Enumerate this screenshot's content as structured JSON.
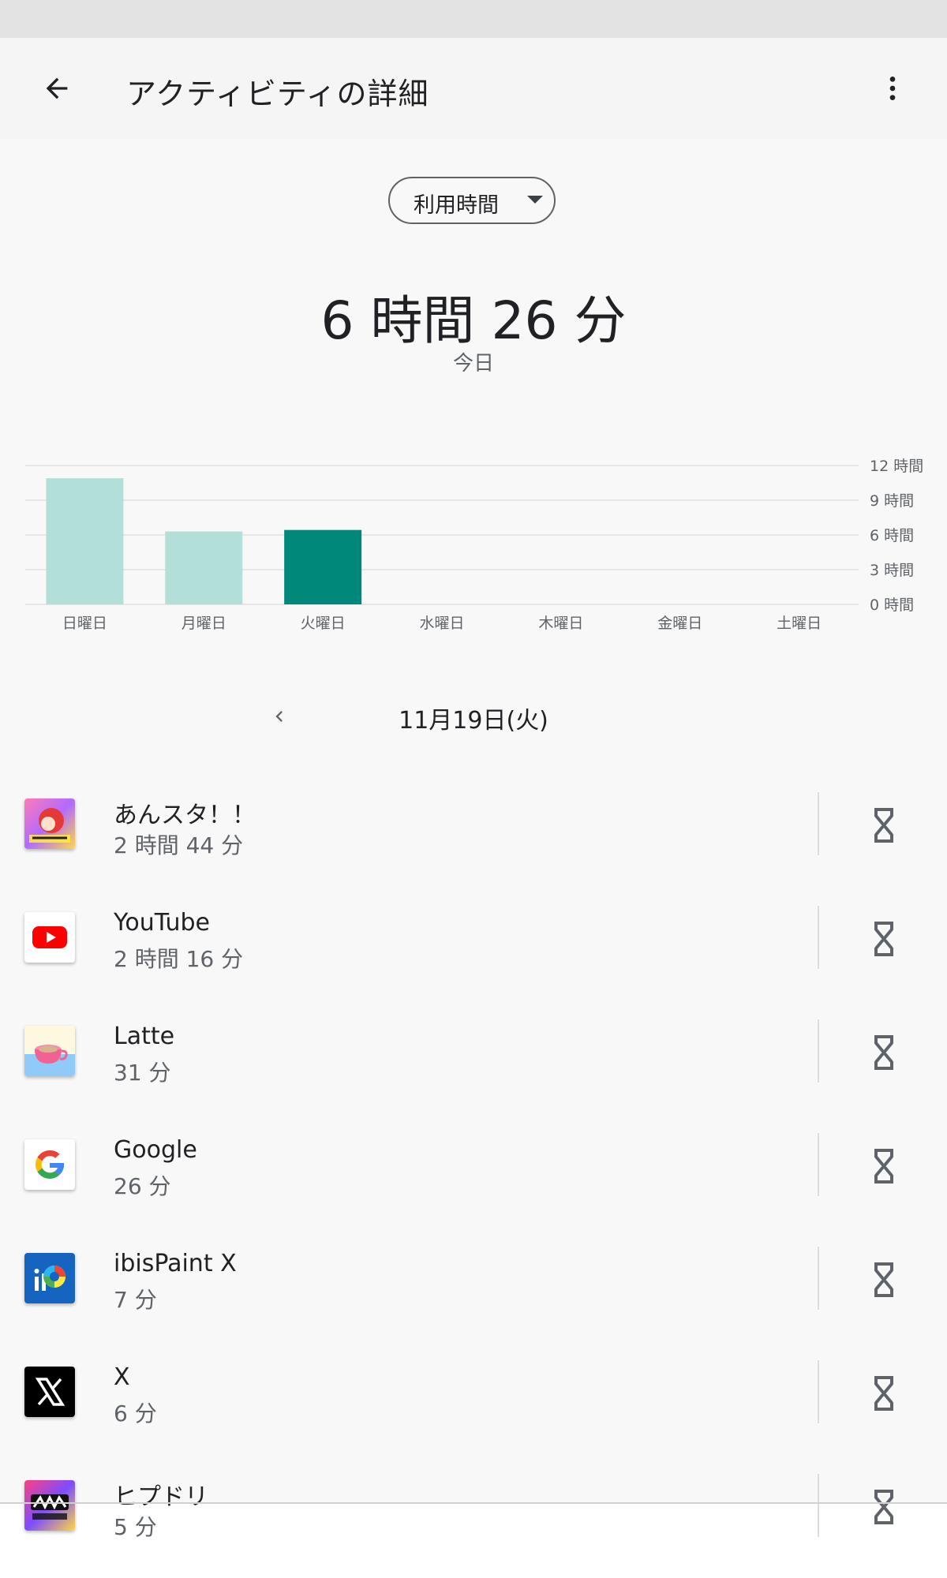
{
  "header": {
    "title": "アクティビティの詳細",
    "back_icon": "arrow-left-icon",
    "more_icon": "more-vert-icon"
  },
  "metric_selector": {
    "value": "利用時間"
  },
  "summary": {
    "total": "6 時間 26 分",
    "label": "今日"
  },
  "chart_data": {
    "type": "bar",
    "categories": [
      "日曜日",
      "月曜日",
      "火曜日",
      "水曜日",
      "木曜日",
      "金曜日",
      "土曜日"
    ],
    "values": [
      10.9,
      6.3,
      6.43,
      0,
      0,
      0,
      0
    ],
    "y_ticks": [
      "0 時間",
      "3 時間",
      "6 時間",
      "9 時間",
      "12 時間"
    ],
    "y_tick_values": [
      0,
      3,
      6,
      9,
      12
    ],
    "ylim": [
      0,
      12
    ],
    "highlight_index": 2,
    "colors": {
      "highlight": "#00897b",
      "normal": "#b2dfd8",
      "grid": "#e0e0e0",
      "label": "#5f6368"
    },
    "grid": true,
    "axis_side": "right"
  },
  "date_nav": {
    "date": "11月19日(火)",
    "prev_icon": "chevron-left-icon"
  },
  "apps": [
    {
      "name": "あんスタ！！",
      "time": "2 時間 44 分",
      "icon": "ensemble-stars-icon"
    },
    {
      "name": "YouTube",
      "time": "2 時間 16 分",
      "icon": "youtube-icon"
    },
    {
      "name": "Latte",
      "time": "31 分",
      "icon": "latte-cup-icon"
    },
    {
      "name": "Google",
      "time": "26 分",
      "icon": "google-g-icon"
    },
    {
      "name": "ibisPaint X",
      "time": "7 分",
      "icon": "ibispaint-icon"
    },
    {
      "name": "X",
      "time": "6 分",
      "icon": "x-logo-icon"
    },
    {
      "name": "ヒプドリ",
      "time": "5 分",
      "icon": "hypnosis-mic-icon"
    }
  ],
  "timer_icon": "hourglass-icon"
}
